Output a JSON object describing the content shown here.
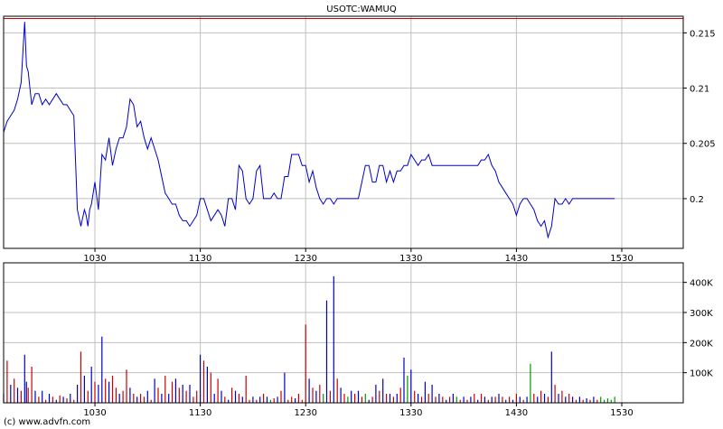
{
  "chart_data": [
    {
      "type": "line",
      "title": "USOTC:WAMUQ",
      "x_ticks": [
        "1030",
        "1130",
        "1230",
        "1330",
        "1430",
        "1530"
      ],
      "x_tick_minutes": [
        630,
        690,
        750,
        810,
        870,
        930
      ],
      "x_range_minutes": [
        578,
        965
      ],
      "y_ticks": [
        "0.2",
        "0.205",
        "0.21",
        "0.215"
      ],
      "y_tick_values": [
        0.2,
        0.205,
        0.21,
        0.215
      ],
      "ylim": [
        0.1955,
        0.2165
      ],
      "reference_line": 0.2163,
      "grid": true,
      "colors": {
        "line": "#0000cc",
        "reference": "#cc0000",
        "grid": "#c0c0c0",
        "frame": "#000000"
      },
      "series": [
        {
          "x": [
            578,
            580,
            582,
            584,
            586,
            588,
            590,
            591,
            592,
            593,
            594,
            596,
            598,
            600,
            602,
            604,
            606,
            608,
            610,
            612,
            614,
            616,
            618,
            620,
            622,
            624,
            625,
            626,
            627,
            628,
            630,
            632,
            634,
            636,
            638,
            640,
            642,
            644,
            646,
            648,
            650,
            652,
            654,
            656,
            658,
            660,
            662,
            664,
            666,
            668,
            670,
            672,
            674,
            676,
            678,
            680,
            682,
            684,
            686,
            688,
            690,
            692,
            694,
            696,
            698,
            700,
            702,
            704,
            706,
            708,
            710,
            712,
            714,
            716,
            718,
            720,
            722,
            724,
            726,
            728,
            730,
            732,
            734,
            736,
            738,
            740,
            742,
            744,
            746,
            748,
            750,
            752,
            754,
            756,
            758,
            760,
            762,
            764,
            766,
            768,
            770,
            772,
            774,
            776,
            778,
            780,
            782,
            784,
            786,
            788,
            790,
            792,
            794,
            796,
            798,
            800,
            802,
            804,
            806,
            808,
            810,
            812,
            814,
            816,
            818,
            820,
            822,
            824,
            826,
            828,
            830,
            832,
            834,
            836,
            838,
            840,
            842,
            844,
            846,
            848,
            850,
            852,
            854,
            856,
            858,
            860,
            862,
            864,
            866,
            868,
            870,
            872,
            874,
            876,
            878,
            880,
            882,
            884,
            886,
            888,
            890,
            892,
            894,
            896,
            898,
            900,
            902,
            904,
            906,
            908,
            910,
            912,
            914,
            916,
            918,
            920,
            922,
            924,
            926
          ],
          "y": [
            0.206,
            0.207,
            0.2075,
            0.208,
            0.209,
            0.2105,
            0.216,
            0.212,
            0.2115,
            0.21,
            0.2085,
            0.2095,
            0.2095,
            0.2085,
            0.209,
            0.2085,
            0.209,
            0.2095,
            0.209,
            0.2085,
            0.2085,
            0.208,
            0.2075,
            0.199,
            0.1975,
            0.199,
            0.1985,
            0.1975,
            0.199,
            0.1995,
            0.2015,
            0.199,
            0.204,
            0.2035,
            0.2055,
            0.203,
            0.2045,
            0.2055,
            0.2055,
            0.2065,
            0.209,
            0.2085,
            0.2065,
            0.207,
            0.2055,
            0.2045,
            0.2055,
            0.2045,
            0.2035,
            0.202,
            0.2005,
            0.2,
            0.1995,
            0.1995,
            0.1985,
            0.198,
            0.198,
            0.1975,
            0.198,
            0.1985,
            0.2,
            0.2,
            0.199,
            0.198,
            0.1985,
            0.199,
            0.1985,
            0.1975,
            0.2,
            0.2,
            0.199,
            0.203,
            0.2025,
            0.2,
            0.1995,
            0.2,
            0.2025,
            0.203,
            0.2,
            0.2,
            0.2,
            0.2005,
            0.2,
            0.2,
            0.202,
            0.202,
            0.204,
            0.204,
            0.204,
            0.203,
            0.203,
            0.2015,
            0.2025,
            0.201,
            0.2,
            0.1995,
            0.2,
            0.2,
            0.1995,
            0.2,
            0.2,
            0.2,
            0.2,
            0.2,
            0.2,
            0.2,
            0.2015,
            0.203,
            0.203,
            0.2015,
            0.2015,
            0.203,
            0.203,
            0.2015,
            0.2025,
            0.2015,
            0.2025,
            0.2025,
            0.203,
            0.203,
            0.204,
            0.2035,
            0.203,
            0.2035,
            0.2035,
            0.204,
            0.203,
            0.203,
            0.203,
            0.203,
            0.203,
            0.203,
            0.203,
            0.203,
            0.203,
            0.203,
            0.203,
            0.203,
            0.203,
            0.203,
            0.2035,
            0.2035,
            0.204,
            0.203,
            0.2025,
            0.2015,
            0.201,
            0.2005,
            0.2,
            0.1995,
            0.1985,
            0.1995,
            0.2,
            0.2,
            0.1995,
            0.199,
            0.198,
            0.1975,
            0.198,
            0.1965,
            0.1975,
            0.2,
            0.1995,
            0.1995,
            0.2,
            0.1995,
            0.2,
            0.2,
            0.2,
            0.2,
            0.2,
            0.2,
            0.2,
            0.2,
            0.2,
            0.2,
            0.2,
            0.2,
            0.2
          ]
        }
      ]
    },
    {
      "type": "bar",
      "x_ticks": [
        "1030",
        "1130",
        "1230",
        "1330",
        "1430",
        "1530"
      ],
      "x_tick_minutes": [
        630,
        690,
        750,
        810,
        870,
        930
      ],
      "x_range_minutes": [
        578,
        965
      ],
      "y_ticks": [
        "100K",
        "200K",
        "300K",
        "400K"
      ],
      "y_tick_values": [
        100000,
        200000,
        300000,
        400000
      ],
      "ylim": [
        0,
        465000
      ],
      "grid": true,
      "colors": {
        "up": "#0000cc",
        "down": "#cc0000",
        "unchanged": "#009900"
      },
      "series": [
        {
          "x": [
            578,
            580,
            582,
            584,
            586,
            588,
            590,
            591,
            592,
            594,
            596,
            598,
            600,
            602,
            604,
            606,
            608,
            610,
            612,
            614,
            616,
            618,
            620,
            622,
            624,
            626,
            628,
            630,
            632,
            634,
            636,
            638,
            640,
            642,
            644,
            646,
            648,
            650,
            652,
            654,
            656,
            658,
            660,
            662,
            664,
            666,
            668,
            670,
            672,
            674,
            676,
            678,
            680,
            682,
            684,
            686,
            688,
            690,
            692,
            694,
            696,
            698,
            700,
            702,
            704,
            706,
            708,
            710,
            712,
            714,
            716,
            718,
            720,
            722,
            724,
            726,
            728,
            730,
            732,
            734,
            736,
            738,
            740,
            742,
            744,
            746,
            748,
            750,
            752,
            754,
            756,
            758,
            760,
            762,
            764,
            766,
            768,
            770,
            772,
            774,
            776,
            778,
            780,
            782,
            784,
            786,
            788,
            790,
            792,
            794,
            796,
            798,
            800,
            802,
            804,
            806,
            808,
            810,
            812,
            814,
            816,
            818,
            820,
            822,
            824,
            826,
            828,
            830,
            832,
            834,
            836,
            838,
            840,
            842,
            844,
            846,
            848,
            850,
            852,
            854,
            856,
            858,
            860,
            862,
            864,
            866,
            868,
            870,
            872,
            874,
            876,
            878,
            880,
            882,
            884,
            886,
            888,
            890,
            892,
            894,
            896,
            898,
            900,
            902,
            904,
            906,
            908,
            910,
            912,
            914,
            916,
            918,
            920,
            922,
            924,
            926
          ],
          "values": [
            30000,
            140000,
            60000,
            80000,
            50000,
            40000,
            160000,
            70000,
            50000,
            120000,
            40000,
            20000,
            40000,
            10000,
            30000,
            20000,
            10000,
            25000,
            20000,
            15000,
            30000,
            10000,
            60000,
            170000,
            90000,
            40000,
            120000,
            70000,
            60000,
            220000,
            80000,
            70000,
            90000,
            50000,
            30000,
            40000,
            110000,
            50000,
            30000,
            20000,
            30000,
            20000,
            40000,
            10000,
            80000,
            50000,
            30000,
            90000,
            30000,
            70000,
            80000,
            50000,
            60000,
            40000,
            60000,
            20000,
            40000,
            160000,
            140000,
            120000,
            100000,
            30000,
            80000,
            40000,
            20000,
            10000,
            50000,
            40000,
            30000,
            20000,
            90000,
            10000,
            20000,
            10000,
            20000,
            30000,
            20000,
            10000,
            15000,
            20000,
            40000,
            100000,
            10000,
            20000,
            15000,
            30000,
            10000,
            260000,
            80000,
            50000,
            40000,
            60000,
            30000,
            340000,
            40000,
            420000,
            80000,
            50000,
            30000,
            20000,
            40000,
            30000,
            40000,
            20000,
            30000,
            10000,
            20000,
            60000,
            40000,
            80000,
            30000,
            30000,
            20000,
            30000,
            50000,
            150000,
            90000,
            110000,
            40000,
            30000,
            20000,
            70000,
            30000,
            60000,
            20000,
            30000,
            20000,
            10000,
            20000,
            30000,
            20000,
            10000,
            20000,
            10000,
            20000,
            30000,
            10000,
            30000,
            20000,
            10000,
            20000,
            20000,
            30000,
            20000,
            10000,
            20000,
            10000,
            30000,
            20000,
            10000,
            20000,
            130000,
            30000,
            20000,
            40000,
            30000,
            20000,
            170000,
            60000,
            30000,
            40000,
            20000,
            30000,
            20000,
            10000,
            20000,
            10000,
            15000,
            10000,
            20000,
            10000,
            20000,
            10000,
            15000,
            10000,
            20000
          ],
          "dirs": [
            "u",
            "d",
            "u",
            "d",
            "u",
            "d",
            "u",
            "u",
            "d",
            "d",
            "u",
            "d",
            "u",
            "d",
            "u",
            "d",
            "u",
            "d",
            "u",
            "d",
            "u",
            "d",
            "u",
            "d",
            "u",
            "d",
            "u",
            "d",
            "u",
            "u",
            "d",
            "u",
            "d",
            "d",
            "u",
            "d",
            "d",
            "u",
            "d",
            "u",
            "d",
            "d",
            "u",
            "d",
            "u",
            "d",
            "u",
            "d",
            "u",
            "d",
            "u",
            "d",
            "u",
            "d",
            "u",
            "d",
            "d",
            "u",
            "d",
            "u",
            "d",
            "u",
            "d",
            "u",
            "d",
            "u",
            "d",
            "u",
            "d",
            "u",
            "d",
            "d",
            "u",
            "d",
            "u",
            "d",
            "u",
            "n",
            "d",
            "u",
            "d",
            "u",
            "d",
            "d",
            "u",
            "d",
            "d",
            "d",
            "u",
            "d",
            "u",
            "d",
            "n",
            "u",
            "d",
            "u",
            "d",
            "u",
            "d",
            "n",
            "u",
            "d",
            "u",
            "d",
            "n",
            "u",
            "d",
            "u",
            "d",
            "u",
            "d",
            "u",
            "d",
            "u",
            "d",
            "u",
            "n",
            "u",
            "d",
            "u",
            "d",
            "u",
            "d",
            "u",
            "d",
            "u",
            "d",
            "u",
            "d",
            "u",
            "n",
            "d",
            "u",
            "d",
            "u",
            "d",
            "u",
            "d",
            "u",
            "d",
            "u",
            "d",
            "u",
            "d",
            "u",
            "d",
            "u",
            "d",
            "u",
            "d",
            "u",
            "n",
            "d",
            "u",
            "d",
            "u",
            "d",
            "u",
            "d",
            "u",
            "d",
            "u",
            "d",
            "u",
            "d",
            "u",
            "d",
            "u",
            "d",
            "u",
            "d"
          ]
        }
      ]
    }
  ],
  "footer": "(c) www.advfn.com"
}
